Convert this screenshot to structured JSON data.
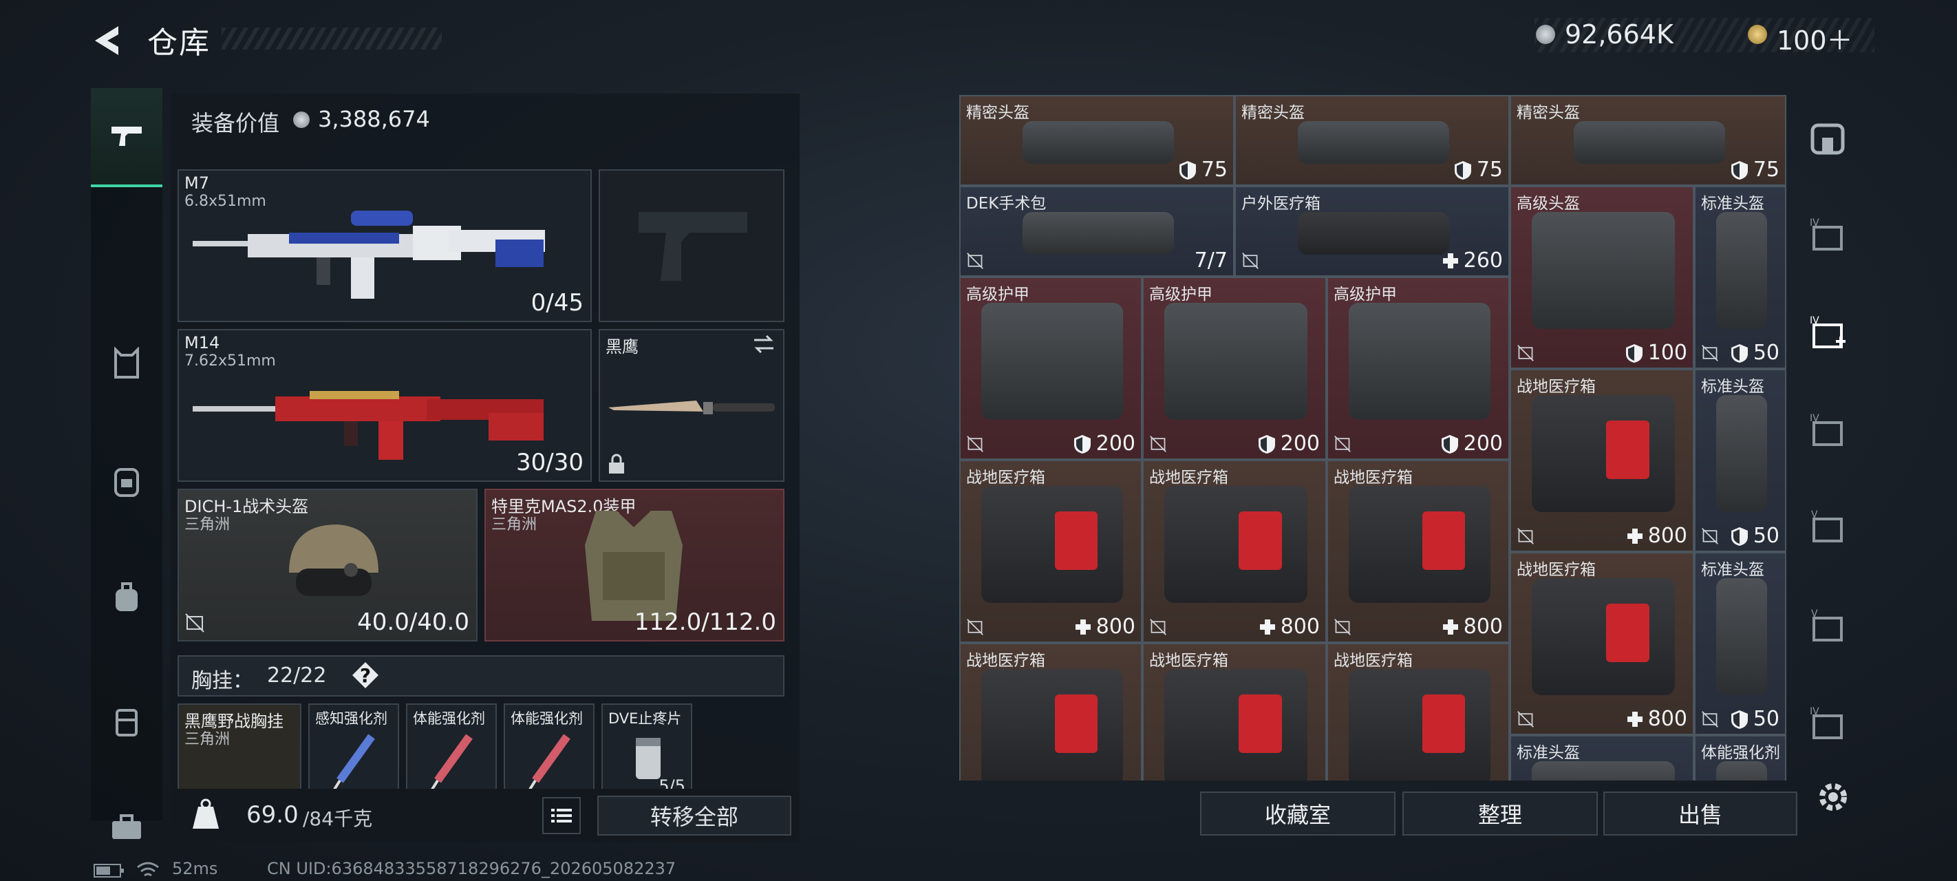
{
  "header": {
    "title": "仓库",
    "currency": "92,664K",
    "points": "100＋"
  },
  "loadout": {
    "value_label": "装备价值",
    "value": "3,388,674",
    "primary": {
      "name": "M7",
      "caliber": "6.8x51mm",
      "ammo": "0/45"
    },
    "secondary": {
      "name": "M14",
      "caliber": "7.62x51mm",
      "ammo": "30/30"
    },
    "melee": {
      "name": "黑鹰"
    },
    "helmet": {
      "name": "DICH-1战术头盔",
      "faction": "三角洲",
      "durability": "40.0/40.0"
    },
    "armor": {
      "name": "特里克MAS2.0装甲",
      "faction": "三角洲",
      "durability": "112.0/112.0"
    },
    "rig_label": "胸挂：",
    "rig_count": "22/22",
    "rig_help": "?",
    "rig_items": [
      {
        "name": "黑鹰野战胸挂",
        "sub": "三角洲"
      },
      {
        "name": "感知强化剂"
      },
      {
        "name": "体能强化剂"
      },
      {
        "name": "体能强化剂"
      },
      {
        "name": "DVE止疼片",
        "count": "5/5"
      }
    ],
    "weight": "69.0",
    "weight_max": "/84千克",
    "transfer_all": "转移全部"
  },
  "storage": {
    "cells": [
      {
        "name": "精密头盔",
        "value": "75",
        "kind": "armor"
      },
      {
        "name": "精密头盔",
        "value": "75",
        "kind": "armor"
      },
      {
        "name": "精密头盔",
        "value": "75",
        "kind": "armor"
      },
      {
        "name": "DEK手术包",
        "value": "7/7",
        "kind": "none"
      },
      {
        "name": "户外医疗箱",
        "value": "260",
        "kind": "heal"
      },
      {
        "name": "高级头盔",
        "value": "100",
        "kind": "armor"
      },
      {
        "name": "标准头盔",
        "value": "50",
        "kind": "armor"
      },
      {
        "name": "高级护甲",
        "value": "200",
        "kind": "armor"
      },
      {
        "name": "高级护甲",
        "value": "200",
        "kind": "armor"
      },
      {
        "name": "高级护甲",
        "value": "200",
        "kind": "armor"
      },
      {
        "name": "战地医疗箱",
        "value": "800",
        "kind": "heal"
      },
      {
        "name": "标准头盔",
        "value": "50",
        "kind": "armor"
      },
      {
        "name": "战地医疗箱",
        "value": "800",
        "kind": "heal"
      },
      {
        "name": "战地医疗箱",
        "value": "800",
        "kind": "heal"
      },
      {
        "name": "战地医疗箱",
        "value": "800",
        "kind": "heal"
      },
      {
        "name": "战地医疗箱",
        "value": "800",
        "kind": "heal"
      },
      {
        "name": "标准头盔",
        "value": "50",
        "kind": "armor"
      },
      {
        "name": "战地医疗箱",
        "value": "",
        "kind": "none"
      },
      {
        "name": "战地医疗箱",
        "value": "",
        "kind": "none"
      },
      {
        "name": "战地医疗箱",
        "value": "",
        "kind": "none"
      },
      {
        "name": "标准头盔",
        "value": "",
        "kind": "none"
      },
      {
        "name": "体能强化剂",
        "value": "",
        "kind": "none"
      }
    ],
    "actions": {
      "collection": "收藏室",
      "sort": "整理",
      "sell": "出售"
    }
  },
  "status_bar": {
    "ping": "52ms",
    "uid": "CN UID:636848335587182962​76_202605082237"
  }
}
